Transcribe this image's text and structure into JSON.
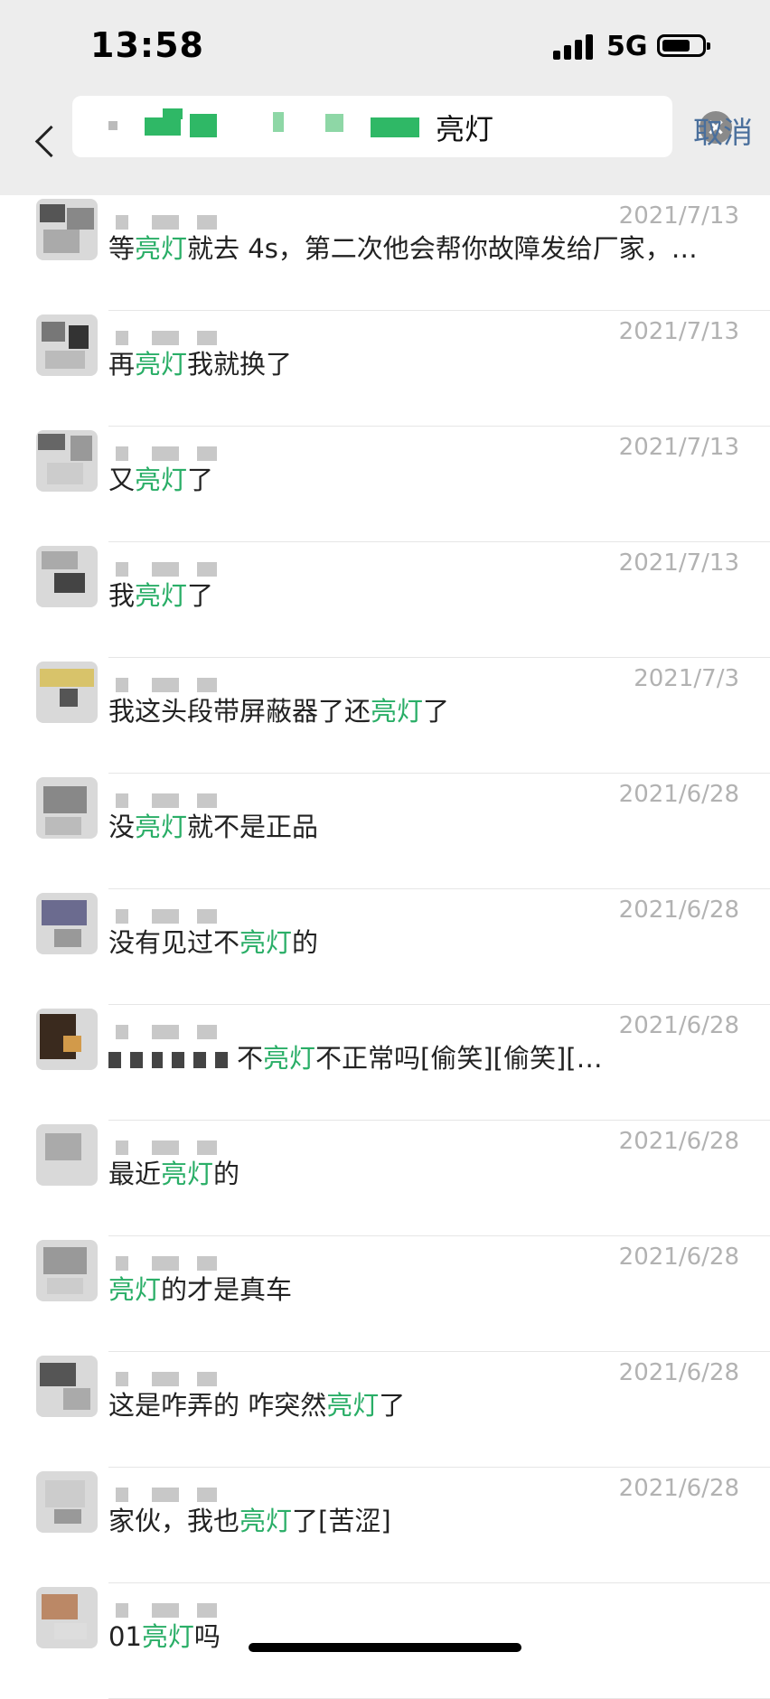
{
  "status_bar": {
    "time": "13:58",
    "network": "5G",
    "battery_level": 0.7
  },
  "search": {
    "query": "亮灯",
    "cancel_label": "取消"
  },
  "results": [
    {
      "date": "2021/7/13",
      "before": "等",
      "highlight": "亮灯",
      "after": "就去 4s，第二次他会帮你故障发给厂家，…"
    },
    {
      "date": "2021/7/13",
      "before": "再",
      "highlight": "亮灯",
      "after": "我就换了"
    },
    {
      "date": "2021/7/13",
      "before": "又",
      "highlight": "亮灯",
      "after": "了"
    },
    {
      "date": "2021/7/13",
      "before": "我",
      "highlight": "亮灯",
      "after": "了"
    },
    {
      "date": "2021/7/3",
      "before": "我这头段带屏蔽器了还",
      "highlight": "亮灯",
      "after": "了"
    },
    {
      "date": "2021/6/28",
      "before": "没",
      "highlight": "亮灯",
      "after": "就不是正品"
    },
    {
      "date": "2021/6/28",
      "before": "没有见过不",
      "highlight": "亮灯",
      "after": "的"
    },
    {
      "date": "2021/6/28",
      "before": "不",
      "highlight": "亮灯",
      "after": "不正常吗[偷笑][偷笑][…"
    },
    {
      "date": "2021/6/28",
      "before": "最近",
      "highlight": "亮灯",
      "after": "的"
    },
    {
      "date": "2021/6/28",
      "before": "",
      "highlight": "亮灯",
      "after": "的才是真车"
    },
    {
      "date": "2021/6/28",
      "before": "这是咋弄的 咋突然",
      "highlight": "亮灯",
      "after": "了"
    },
    {
      "date": "2021/6/28",
      "before": "家伙，我也",
      "highlight": "亮灯",
      "after": "了[苦涩]"
    },
    {
      "date": "",
      "before": "01",
      "highlight": "亮灯",
      "after": "吗"
    }
  ]
}
